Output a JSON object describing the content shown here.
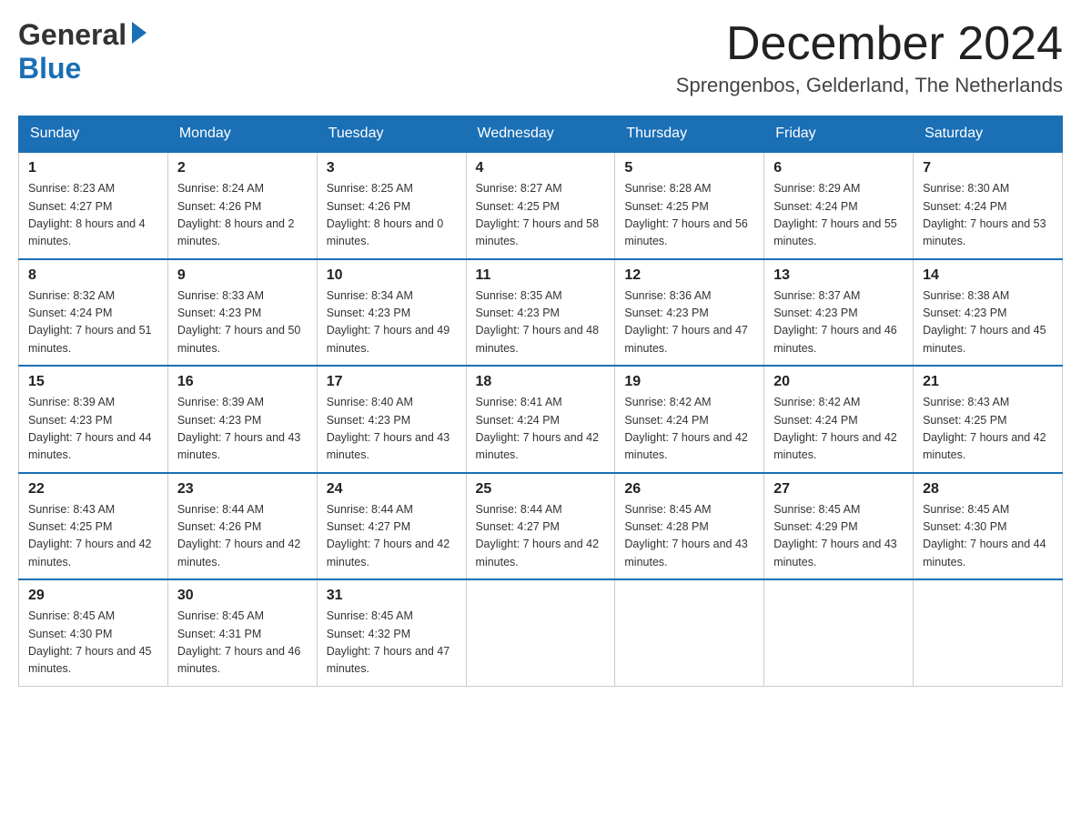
{
  "logo": {
    "general": "General",
    "blue": "Blue",
    "arrow": "▶"
  },
  "title": {
    "month_year": "December 2024",
    "location": "Sprengenbos, Gelderland, The Netherlands"
  },
  "calendar": {
    "headers": [
      "Sunday",
      "Monday",
      "Tuesday",
      "Wednesday",
      "Thursday",
      "Friday",
      "Saturday"
    ],
    "weeks": [
      [
        {
          "day": "1",
          "sunrise": "Sunrise: 8:23 AM",
          "sunset": "Sunset: 4:27 PM",
          "daylight": "Daylight: 8 hours and 4 minutes."
        },
        {
          "day": "2",
          "sunrise": "Sunrise: 8:24 AM",
          "sunset": "Sunset: 4:26 PM",
          "daylight": "Daylight: 8 hours and 2 minutes."
        },
        {
          "day": "3",
          "sunrise": "Sunrise: 8:25 AM",
          "sunset": "Sunset: 4:26 PM",
          "daylight": "Daylight: 8 hours and 0 minutes."
        },
        {
          "day": "4",
          "sunrise": "Sunrise: 8:27 AM",
          "sunset": "Sunset: 4:25 PM",
          "daylight": "Daylight: 7 hours and 58 minutes."
        },
        {
          "day": "5",
          "sunrise": "Sunrise: 8:28 AM",
          "sunset": "Sunset: 4:25 PM",
          "daylight": "Daylight: 7 hours and 56 minutes."
        },
        {
          "day": "6",
          "sunrise": "Sunrise: 8:29 AM",
          "sunset": "Sunset: 4:24 PM",
          "daylight": "Daylight: 7 hours and 55 minutes."
        },
        {
          "day": "7",
          "sunrise": "Sunrise: 8:30 AM",
          "sunset": "Sunset: 4:24 PM",
          "daylight": "Daylight: 7 hours and 53 minutes."
        }
      ],
      [
        {
          "day": "8",
          "sunrise": "Sunrise: 8:32 AM",
          "sunset": "Sunset: 4:24 PM",
          "daylight": "Daylight: 7 hours and 51 minutes."
        },
        {
          "day": "9",
          "sunrise": "Sunrise: 8:33 AM",
          "sunset": "Sunset: 4:23 PM",
          "daylight": "Daylight: 7 hours and 50 minutes."
        },
        {
          "day": "10",
          "sunrise": "Sunrise: 8:34 AM",
          "sunset": "Sunset: 4:23 PM",
          "daylight": "Daylight: 7 hours and 49 minutes."
        },
        {
          "day": "11",
          "sunrise": "Sunrise: 8:35 AM",
          "sunset": "Sunset: 4:23 PM",
          "daylight": "Daylight: 7 hours and 48 minutes."
        },
        {
          "day": "12",
          "sunrise": "Sunrise: 8:36 AM",
          "sunset": "Sunset: 4:23 PM",
          "daylight": "Daylight: 7 hours and 47 minutes."
        },
        {
          "day": "13",
          "sunrise": "Sunrise: 8:37 AM",
          "sunset": "Sunset: 4:23 PM",
          "daylight": "Daylight: 7 hours and 46 minutes."
        },
        {
          "day": "14",
          "sunrise": "Sunrise: 8:38 AM",
          "sunset": "Sunset: 4:23 PM",
          "daylight": "Daylight: 7 hours and 45 minutes."
        }
      ],
      [
        {
          "day": "15",
          "sunrise": "Sunrise: 8:39 AM",
          "sunset": "Sunset: 4:23 PM",
          "daylight": "Daylight: 7 hours and 44 minutes."
        },
        {
          "day": "16",
          "sunrise": "Sunrise: 8:39 AM",
          "sunset": "Sunset: 4:23 PM",
          "daylight": "Daylight: 7 hours and 43 minutes."
        },
        {
          "day": "17",
          "sunrise": "Sunrise: 8:40 AM",
          "sunset": "Sunset: 4:23 PM",
          "daylight": "Daylight: 7 hours and 43 minutes."
        },
        {
          "day": "18",
          "sunrise": "Sunrise: 8:41 AM",
          "sunset": "Sunset: 4:24 PM",
          "daylight": "Daylight: 7 hours and 42 minutes."
        },
        {
          "day": "19",
          "sunrise": "Sunrise: 8:42 AM",
          "sunset": "Sunset: 4:24 PM",
          "daylight": "Daylight: 7 hours and 42 minutes."
        },
        {
          "day": "20",
          "sunrise": "Sunrise: 8:42 AM",
          "sunset": "Sunset: 4:24 PM",
          "daylight": "Daylight: 7 hours and 42 minutes."
        },
        {
          "day": "21",
          "sunrise": "Sunrise: 8:43 AM",
          "sunset": "Sunset: 4:25 PM",
          "daylight": "Daylight: 7 hours and 42 minutes."
        }
      ],
      [
        {
          "day": "22",
          "sunrise": "Sunrise: 8:43 AM",
          "sunset": "Sunset: 4:25 PM",
          "daylight": "Daylight: 7 hours and 42 minutes."
        },
        {
          "day": "23",
          "sunrise": "Sunrise: 8:44 AM",
          "sunset": "Sunset: 4:26 PM",
          "daylight": "Daylight: 7 hours and 42 minutes."
        },
        {
          "day": "24",
          "sunrise": "Sunrise: 8:44 AM",
          "sunset": "Sunset: 4:27 PM",
          "daylight": "Daylight: 7 hours and 42 minutes."
        },
        {
          "day": "25",
          "sunrise": "Sunrise: 8:44 AM",
          "sunset": "Sunset: 4:27 PM",
          "daylight": "Daylight: 7 hours and 42 minutes."
        },
        {
          "day": "26",
          "sunrise": "Sunrise: 8:45 AM",
          "sunset": "Sunset: 4:28 PM",
          "daylight": "Daylight: 7 hours and 43 minutes."
        },
        {
          "day": "27",
          "sunrise": "Sunrise: 8:45 AM",
          "sunset": "Sunset: 4:29 PM",
          "daylight": "Daylight: 7 hours and 43 minutes."
        },
        {
          "day": "28",
          "sunrise": "Sunrise: 8:45 AM",
          "sunset": "Sunset: 4:30 PM",
          "daylight": "Daylight: 7 hours and 44 minutes."
        }
      ],
      [
        {
          "day": "29",
          "sunrise": "Sunrise: 8:45 AM",
          "sunset": "Sunset: 4:30 PM",
          "daylight": "Daylight: 7 hours and 45 minutes."
        },
        {
          "day": "30",
          "sunrise": "Sunrise: 8:45 AM",
          "sunset": "Sunset: 4:31 PM",
          "daylight": "Daylight: 7 hours and 46 minutes."
        },
        {
          "day": "31",
          "sunrise": "Sunrise: 8:45 AM",
          "sunset": "Sunset: 4:32 PM",
          "daylight": "Daylight: 7 hours and 47 minutes."
        },
        null,
        null,
        null,
        null
      ]
    ]
  }
}
